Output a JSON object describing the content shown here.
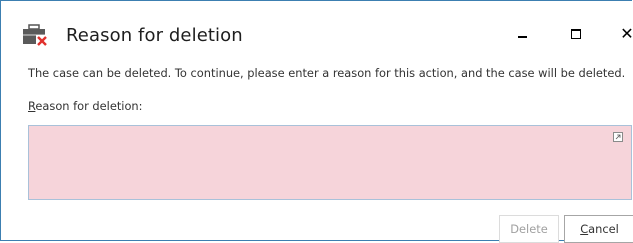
{
  "dialog": {
    "title": "Reason for deletion",
    "app_icon": "briefcase-delete-icon",
    "controls": {
      "minimize_icon": "minimize-icon",
      "maximize_icon": "maximize-icon",
      "close_icon": "close-icon",
      "close_glyph": "✕"
    }
  },
  "message": "The case can be deleted. To continue, please enter a reason for this action, and the case will be deleted.",
  "reason_field": {
    "label_accesskey": "R",
    "label_rest": "eason for deletion:",
    "value": "",
    "background_color": "#f6d4da",
    "expand_icon": "expand-icon"
  },
  "buttons": {
    "delete_label": "Delete",
    "delete_enabled": false,
    "cancel_accesskey": "C",
    "cancel_rest": "ancel"
  }
}
